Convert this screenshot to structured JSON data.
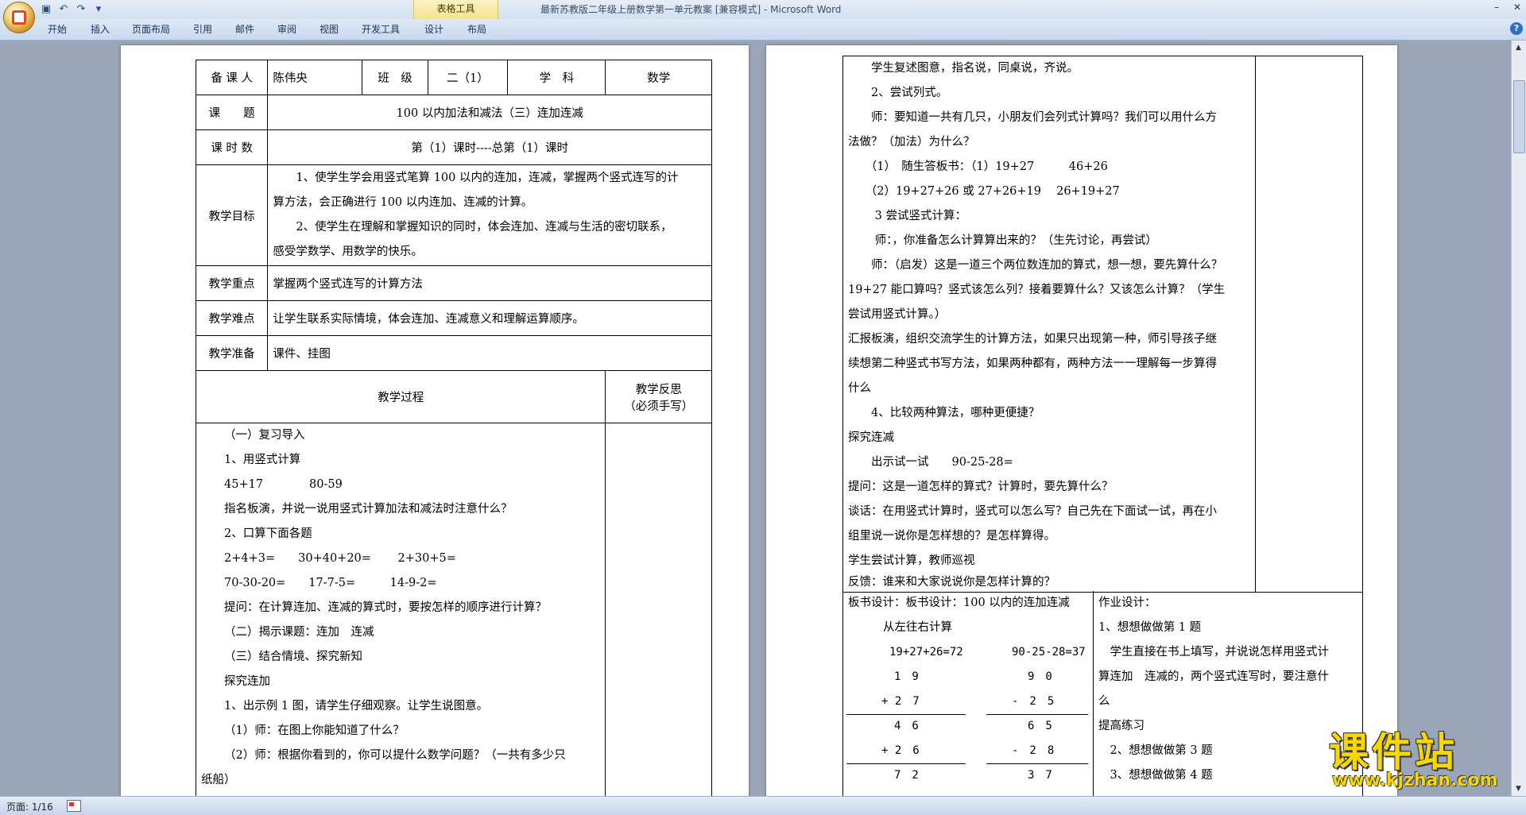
{
  "window": {
    "title": "最新苏教版二年级上册数学第一单元教案 [兼容模式] - Microsoft Word",
    "context_tab": "表格工具"
  },
  "ribbon": {
    "tabs": [
      "开始",
      "插入",
      "页面布局",
      "引用",
      "邮件",
      "审阅",
      "视图",
      "开发工具",
      "设计",
      "布局"
    ]
  },
  "status": {
    "page": "页面: 1/16"
  },
  "page1": {
    "r1": {
      "l1": "备 课 人",
      "v1": "陈伟央",
      "l2": "班　级",
      "v2": "二（1）",
      "l3": "学　科",
      "v3": "数学"
    },
    "r2": {
      "label": "课　　题",
      "value": "100 以内加法和减法（三）连加连减"
    },
    "r3": {
      "label": "课 时 数",
      "value": "第（1）课时----总第（1）课时"
    },
    "r4": {
      "label": "教学目标",
      "lines": [
        "1、使学生学会用竖式笔算 100 以内的连加，连减，掌握两个竖式连写的计",
        "算方法，会正确进行 100 以内连加、连减的计算。",
        "2、使学生在理解和掌握知识的同时，体会连加、连减与生活的密切联系，",
        "感受学数学、用数学的快乐。"
      ]
    },
    "r5": {
      "label": "教学重点",
      "value": "掌握两个竖式连写的计算方法"
    },
    "r6": {
      "label": "教学难点",
      "value": "让学生联系实际情境，体会连加、连减意义和理解运算顺序。"
    },
    "r7": {
      "label": "教学准备",
      "value": "课件、挂图"
    },
    "r8": {
      "process": "教学过程",
      "reflect1": "教学反思",
      "reflect2": "（必须手写）"
    },
    "body": [
      "（一）复习导入",
      "1、用竖式计算",
      "45+17　　　　80-59",
      "指名板演，并说一说用竖式计算加法和减法时注意什么？",
      "2、口算下面各题",
      "2+4+3=　　30+40+20=　　 2+30+5=",
      "70-30-20=　　17-7-5=　　　14-9-2=",
      "提问：在计算连加、连减的算式时，要按怎样的顺序进行计算？",
      "（二）揭示课题：连加　连减",
      "（三）结合情境、探究新知",
      "探究连加",
      "1、出示例 1 图，请学生仔细观察。让学生说图意。",
      "（1）师：在图上你能知道了什么？",
      "（2）师：根据你看到的，你可以提什么数学问题？（一共有多少只",
      "纸船）"
    ]
  },
  "page2": {
    "body": [
      "　　学生复述图意，指名说，同桌说，齐说。",
      "　　2、尝试列式。",
      "　　师：要知道一共有几只，小朋友们会列式计算吗？我们可以用什么方",
      "法做？（加法）为什么？",
      "　　（1）　随生答板书：（1）19+27　　　46+26",
      "　　（2）19+27+26 或 27+26+19　 26+19+27",
      "　　 3 尝试竖式计算：",
      "　　 师：，你准备怎么计算算出来的？（生先讨论，再尝试）",
      "　　师：（启发）这是一道三个两位数连加的算式，想一想，要先算什么？",
      "19+27 能口算吗？竖式该怎么列？接着要算什么？又该怎么计算？（学生",
      "尝试用竖式计算。）",
      "汇报板演，组织交流学生的计算方法，如果只出现第一种，师引导孩子继",
      "续想第二种竖式书写方法，如果两种都有，两种方法一一理解每一步算得",
      "什么",
      "　　4、比较两种算法，哪种更便捷？",
      "探究连减",
      "　　出示试一试　　90-25-28=",
      "提问：这是一道怎样的算式？计算时，要先算什么？",
      "谈话：在用竖式计算时，竖式可以怎么写？自己先在下面试一试，再在小",
      "组里说一说你是怎样想的？是怎样算得。",
      "学生尝试计算，教师巡视",
      "反馈：谁来和大家说说你是怎样计算的？"
    ],
    "board": {
      "title": "板书设计：板书设计：100 以内的连加连减",
      "subtitle": "从左往右计算",
      "eq1": "19+27+26=72",
      "eq2": "90-25-28=37",
      "rows": [
        {
          "a": "1　9",
          "b": "9　0"
        },
        {
          "a": "+ 2　7",
          "b": "-　2　5"
        },
        {
          "a": "4　6",
          "b": "6　5"
        },
        {
          "a": "+ 2　6",
          "b": "-　2　8"
        },
        {
          "a": "7　2",
          "b": "3　7"
        }
      ]
    },
    "homework": [
      "作业设计：",
      "1、想想做做第 1 题",
      "　学生直接在书上填写，并说说怎样用竖式计",
      "算连加　连减的，两个竖式连写时，要注意什",
      "么",
      "提高练习",
      "　2、想想做做第 3 题",
      "　3、想想做做第 4 题"
    ]
  },
  "logo": {
    "main": "课件站",
    "url": "www.kjzhan.com"
  },
  "colors": {
    "titlebar": "#dbe6f4",
    "ribbon": "#c9d9ee",
    "workspace": "#9aa6b8",
    "logo": "#f7d700"
  },
  "icons": [
    "office-button-icon",
    "save-icon",
    "undo-icon",
    "redo-icon",
    "customize-qat-icon",
    "minimize-icon",
    "close-icon",
    "help-icon"
  ]
}
